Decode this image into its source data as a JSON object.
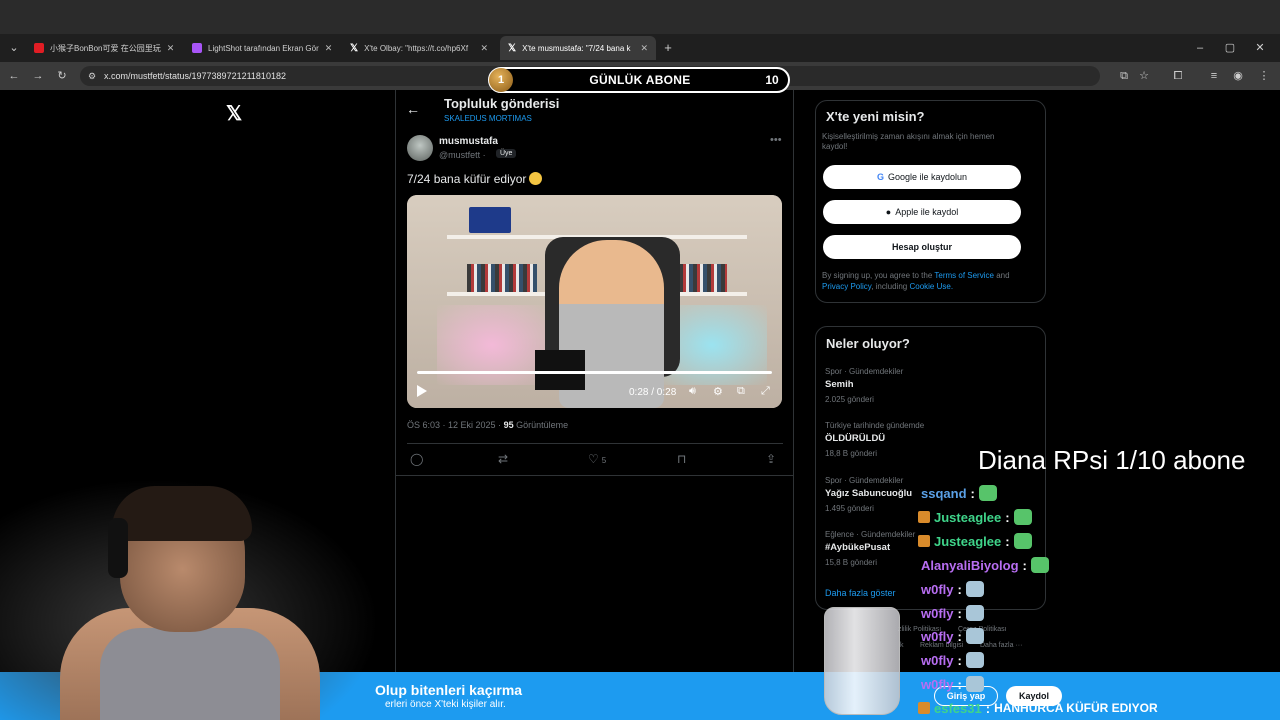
{
  "browser": {
    "tabs": [
      {
        "title": "小猴子BonBon可爱 在公园里玩",
        "favicon_color": "#e11d24",
        "active": false
      },
      {
        "title": "LightShot tarafından Ekran Gör",
        "favicon_color": "#a855f7",
        "active": false
      },
      {
        "title": "X'te Olbay: \"https://t.co/hp6Xf",
        "favicon_color": "#ffffff",
        "active": false
      },
      {
        "title": "X'te musmustafa: \"7/24 bana k",
        "favicon_color": "#ffffff",
        "active": true
      }
    ],
    "new_tab": "+",
    "url": "x.com/mustfett/status/1977389721211810182"
  },
  "overlay": {
    "sub_rank": "1",
    "sub_label": "GÜNLÜK ABONE",
    "sub_count": "10"
  },
  "post": {
    "header_title": "Topluluk gönderisi",
    "header_sub": "SKALEDUS MORTIMAS",
    "name": "musmustafa",
    "handle": "@mustfett ·",
    "badge": "Üye",
    "text": "7/24 bana küfür ediyor",
    "video_time": "0:28 / 0:28",
    "video_progress": 1.0,
    "meta_time": "ÖS 6:03 · 12 Eki 2025 ·",
    "views": "95",
    "views_label": "Görüntüleme",
    "like_count": "5"
  },
  "signup_card": {
    "title": "X'te yeni misin?",
    "desc": "Kişiselleştirilmiş zaman akışını almak için hemen kaydol!",
    "google": "Google ile kaydolun",
    "apple": "Apple ile kaydol",
    "create": "Hesap oluştur",
    "legal_1": "By signing up, you agree to the",
    "terms": "Terms of Service",
    "legal_2": "and",
    "privacy": "Privacy Policy",
    "legal_3": ", including",
    "cookie": "Cookie Use."
  },
  "trends": {
    "title": "Neler oluyor?",
    "items": [
      {
        "cat": "Spor · Gündemdekiler",
        "name": "Semih",
        "count": "2.025 gönderi"
      },
      {
        "cat": "Türkiye tarihinde gündemde",
        "name": "ÖLDÜRÜLDÜ",
        "count": "18,8 B gönderi"
      },
      {
        "cat": "Spor · Gündemdekiler",
        "name": "Yağız Sabuncuoğlu",
        "count": "1.495 gönderi"
      },
      {
        "cat": "Eğlence · Gündemdekiler",
        "name": "#AybükePusat",
        "count": "15,8 B gönderi"
      }
    ],
    "show_more": "Daha fazla göster"
  },
  "footer": {
    "links": [
      "zlilik Politikası",
      "Çerez Politikası",
      "k",
      "Reklam bilgisi",
      "Daha fazla ···"
    ]
  },
  "banner": {
    "title": "Olup bitenleri kaçırma",
    "sub": "erleri önce X'teki kişiler alır.",
    "login": "Giriş yap",
    "signup": "Kaydol"
  },
  "stream": {
    "alert": "Diana RPsi 1/10 abone",
    "chat": [
      {
        "user": "ssqand",
        "color": "#5aa0e6",
        "badge": false,
        "emote": "green"
      },
      {
        "user": "Justeaglee",
        "color": "#3fd48a",
        "badge": true,
        "emote": "green"
      },
      {
        "user": "Justeaglee",
        "color": "#3fd48a",
        "badge": true,
        "emote": "green"
      },
      {
        "user": "AlanyaliBiyolog",
        "color": "#b86ef2",
        "badge": false,
        "emote": "green"
      },
      {
        "user": "w0fly",
        "color": "#b86ef2",
        "badge": false,
        "emote": "w"
      },
      {
        "user": "w0fly",
        "color": "#b86ef2",
        "badge": false,
        "emote": "w"
      },
      {
        "user": "w0fly",
        "color": "#b86ef2",
        "badge": false,
        "emote": "w"
      },
      {
        "user": "w0fly",
        "color": "#b86ef2",
        "badge": false,
        "emote": "w"
      },
      {
        "user": "w0fly",
        "color": "#b86ef2",
        "badge": false,
        "emote": "w"
      },
      {
        "user": "esfes31",
        "color": "#3fd48a",
        "badge": true,
        "message": "HANHURCA KÜFÜR EDIYOR"
      }
    ]
  }
}
